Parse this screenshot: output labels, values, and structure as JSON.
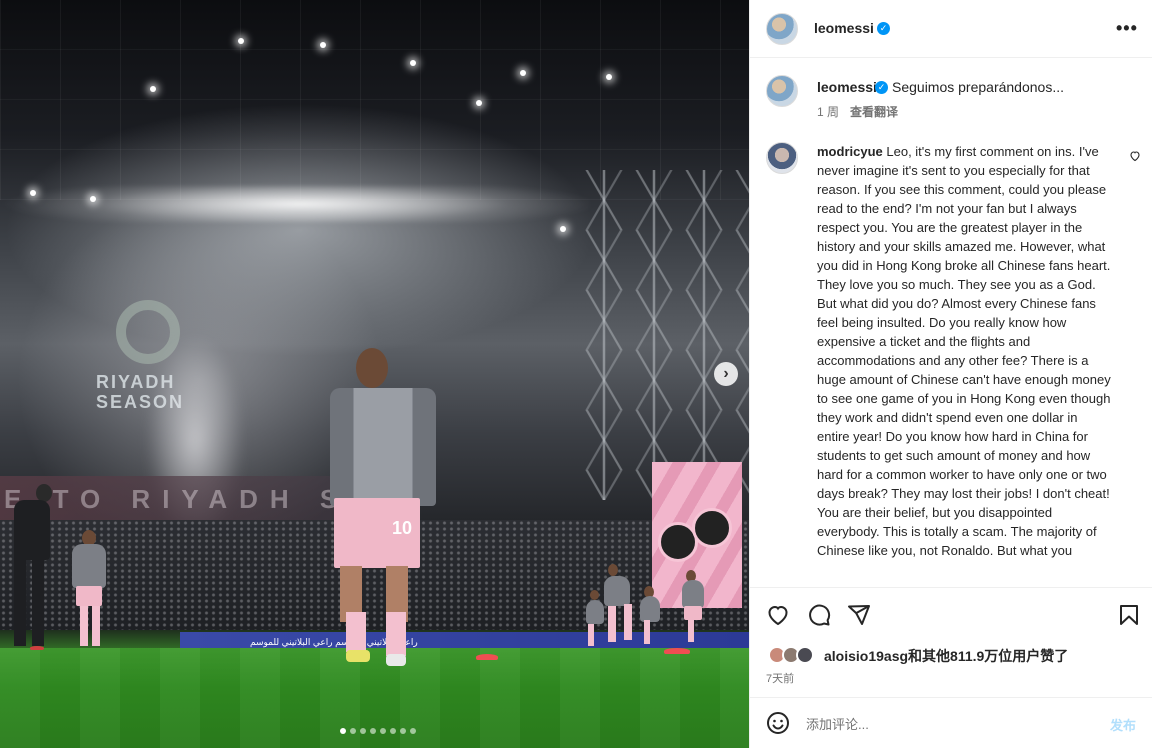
{
  "post": {
    "author": "leomessi",
    "header_more": "•••",
    "caption_text": "Seguimos preparándonos...",
    "caption_time": "1 周",
    "caption_translate": "查看翻译",
    "comment_user": "modricyue",
    "comment_text": "Leo, it's my first comment on ins. I've never imagine it's sent to you especially for that reason. If you see this comment, could you please read to the end? I'm not your fan but I always respect you. You are the greatest player in the history and your skills amazed me. However, what you did in Hong Kong broke all Chinese fans heart. They love you so much. They see you as a God. But what did you do? Almost every Chinese fans feel being insulted. Do you really know how expensive a ticket and the flights and accommodations and any other fee? There is a huge amount of Chinese can't have enough money to see one game of you in Hong Kong even though they work and didn't spend even one dollar in entire year! Do you know how hard in China for students to get such amount of money and how hard for a common worker to have only one or two days break? They may lost their jobs! I don't cheat! You are their belief, but you disappointed everybody. This is totally a scam. The majority of Chinese like you, not Ronaldo. But what you",
    "likes_text": "aloisio19asg和其他811.9万位用户赞了",
    "posted_ago": "7天前",
    "comment_placeholder": "添加评论...",
    "post_button": "发布"
  },
  "media": {
    "riyadh_text": "RIYADH SEASON",
    "banner_text": "E TO RIYADH SEA",
    "ad_text": "راعي البلاتيني للموسم    راعي البلاتيني للموسم",
    "shirt_number": "10",
    "carousel_dots": 8,
    "carousel_active": 0
  },
  "icons": {
    "verified": "verified-badge-icon",
    "heart": "heart-icon",
    "comment": "comment-icon",
    "share": "share-icon",
    "bookmark": "bookmark-icon",
    "emoji": "emoji-icon",
    "next": "chevron-right-icon",
    "more": "more-horizontal-icon"
  },
  "colors": {
    "accent": "#0095f6",
    "post_button_disabled": "#b2dffc",
    "muted_text": "#737373"
  }
}
